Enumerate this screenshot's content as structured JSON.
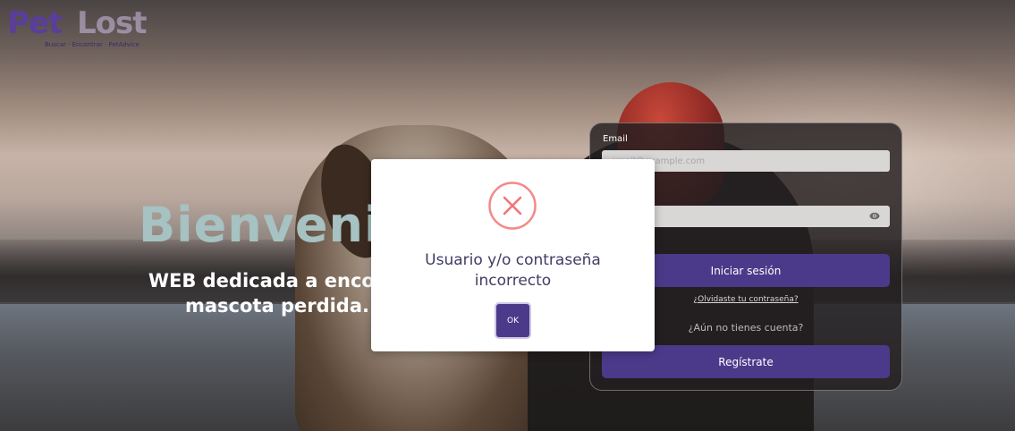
{
  "logo": {
    "text_pet": "Pet",
    "text_lost": "Lost",
    "tagline": "Buscar · Encontrar · PetAdvice"
  },
  "hero": {
    "title": "Bienvenid",
    "subtitle_line1": "WEB dedicada a encontr",
    "subtitle_line2": "mascota perdida."
  },
  "login": {
    "email_label": "Email",
    "email_placeholder": "email@example.com",
    "password_value": "",
    "login_button": "Iniciar sesión",
    "forgot_link": "¿Olvidaste tu contraseña?",
    "no_account_text": "¿Aún no tienes cuenta?",
    "register_button": "Regístrate"
  },
  "modal": {
    "message_line1": "Usuario y/o contraseña",
    "message_line2": "incorrecto",
    "ok_button": "OK"
  },
  "colors": {
    "brand_purple": "#4b3a8a",
    "error_red": "#f27474",
    "hero_title": "#a6c2c2"
  },
  "icons": [
    "error-x-icon",
    "eye-icon"
  ]
}
